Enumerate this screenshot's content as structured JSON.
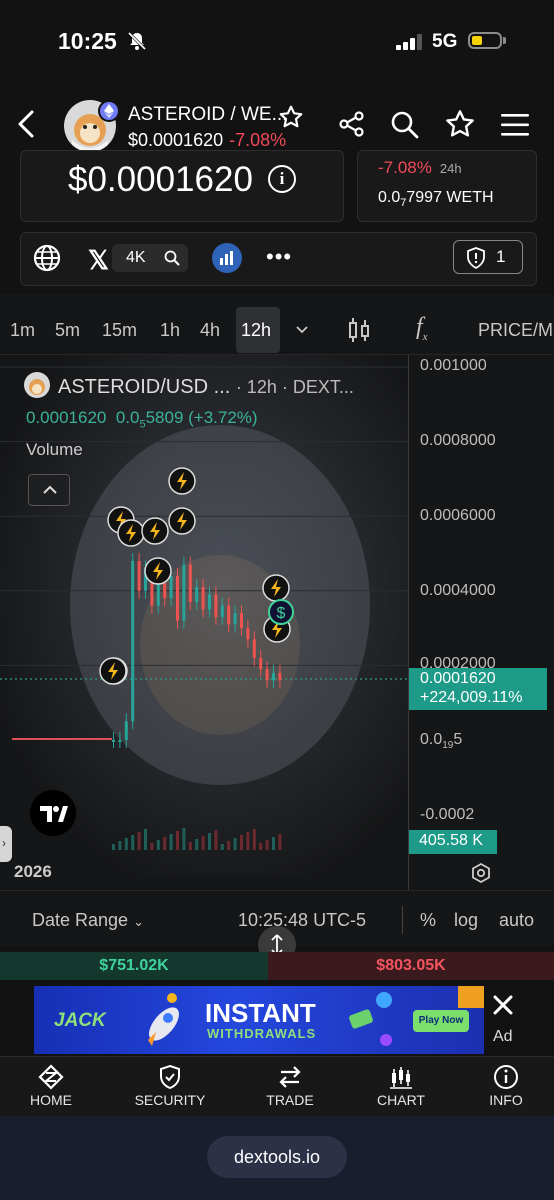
{
  "status_bar": {
    "time": "10:25",
    "network": "5G"
  },
  "header": {
    "pair": "ASTEROID / WE...",
    "price": "$0.0001620",
    "change": "-7.08%"
  },
  "price_card": {
    "big_price": "$0.0001620",
    "info_icon": "i"
  },
  "change_card": {
    "change": "-7.08%",
    "period": "24h",
    "weth_prefix": "0.0",
    "weth_sub": "7",
    "weth_suffix": "7997 WETH"
  },
  "social": {
    "holders": "4K",
    "shield_count": "1"
  },
  "timeframes": [
    "1m",
    "5m",
    "15m",
    "1h",
    "4h",
    "12h"
  ],
  "active_timeframe": "12h",
  "toolbar": {
    "fx": "f",
    "fx_sub": "x",
    "price_label": "PRICE/M"
  },
  "chart_legend": {
    "symbol": "ASTEROID/USD ...",
    "interval": "· 12h · DEXT...",
    "price": "0.0001620",
    "change_prefix": "0.0",
    "change_sub": "5",
    "change_suffix": "5809 (+3.72%)",
    "volume_label": "Volume"
  },
  "chart_data": {
    "type": "candlestick",
    "y_ticks": [
      "0.001000",
      "0.0008000",
      "0.0006000",
      "0.0004000",
      "0.0002000",
      "-0.0002"
    ],
    "y_tick_small": {
      "prefix": "0.0",
      "sub": "19",
      "suffix": "5"
    },
    "current_price": "0.0001620",
    "current_change": "+224,009.11%",
    "volume_label": "405.58 K",
    "x_label": "2026",
    "close_values": [
      0.0,
      0.0,
      5e-05,
      0.00048,
      0.0004,
      0.00046,
      0.00036,
      0.00042,
      0.00038,
      0.00044,
      0.00032,
      0.00047,
      0.00037,
      0.00041,
      0.00035,
      0.00039,
      0.00033,
      0.00036,
      0.00031,
      0.00034,
      0.0003,
      0.00027,
      0.00022,
      0.00019,
      0.00016,
      0.00018,
      0.00016
    ]
  },
  "bottom_bar": {
    "date_range": "Date Range",
    "clock": "10:25:48 UTC-5",
    "pct": "%",
    "log": "log",
    "auto": "auto"
  },
  "flow": {
    "buy": "$751.02K",
    "sell": "$803.05K"
  },
  "ad": {
    "brand": "JACK",
    "title": "INSTANT",
    "subtitle": "WITHDRAWALS",
    "cta": "Play Now",
    "label": "Ad"
  },
  "nav": [
    "HOME",
    "SECURITY",
    "TRADE",
    "CHART",
    "INFO"
  ],
  "browser": {
    "url": "dextools.io"
  }
}
